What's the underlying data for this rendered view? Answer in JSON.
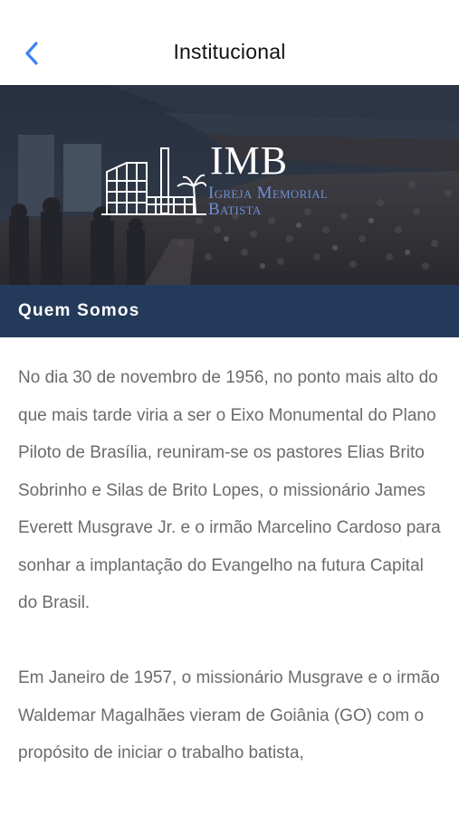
{
  "navbar": {
    "title": "Institucional",
    "back_icon": "chevron-left-icon",
    "accent_color": "#3b82f6"
  },
  "banner": {
    "logo": {
      "abbr": "IMB",
      "name_line1": "Igreja Memorial",
      "name_line2": "Batista"
    }
  },
  "section": {
    "title": "Quem Somos",
    "background": "#243a5a"
  },
  "content": {
    "paragraphs": [
      "No dia 30 de novembro de 1956, no ponto mais alto do que mais tarde viria a ser o Eixo Monumental do Plano Piloto de Brasília, reuniram-se os pastores Elias Brito Sobrinho e Silas de Brito Lopes, o missionário James Everett Musgrave Jr. e o irmão Marcelino Cardoso para sonhar a implantação do Evangelho na futura Capital do Brasil.",
      "Em Janeiro de 1957, o missionário Musgrave e o irmão Waldemar Magalhães vieram de Goiânia (GO) com o propósito de iniciar o trabalho batista,"
    ]
  }
}
